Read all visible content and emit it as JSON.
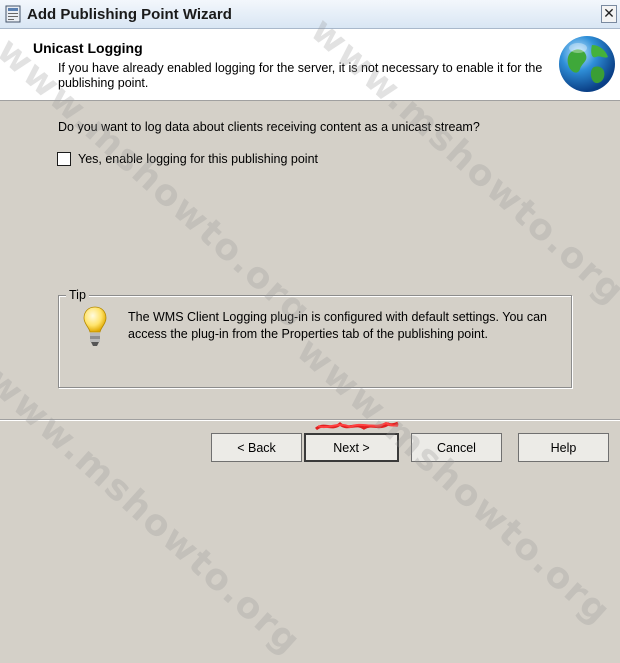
{
  "window": {
    "title": "Add Publishing Point Wizard",
    "close_label": "✕"
  },
  "header": {
    "title": "Unicast Logging",
    "subtitle": "If you have already enabled logging for the server, it is not necessary to enable it for the publishing point."
  },
  "body": {
    "question": "Do you want to log data about clients receiving content as a unicast stream?",
    "checkbox_label": "Yes, enable logging for this publishing point",
    "checkbox_checked": false
  },
  "tip": {
    "legend": "Tip",
    "text": "The WMS Client Logging plug-in is configured with default settings. You can access the plug-in from the Properties tab of the publishing point."
  },
  "buttons": {
    "back": "< Back",
    "next": "Next >",
    "cancel": "Cancel",
    "help": "Help"
  },
  "watermark": "www.mshowto.org"
}
